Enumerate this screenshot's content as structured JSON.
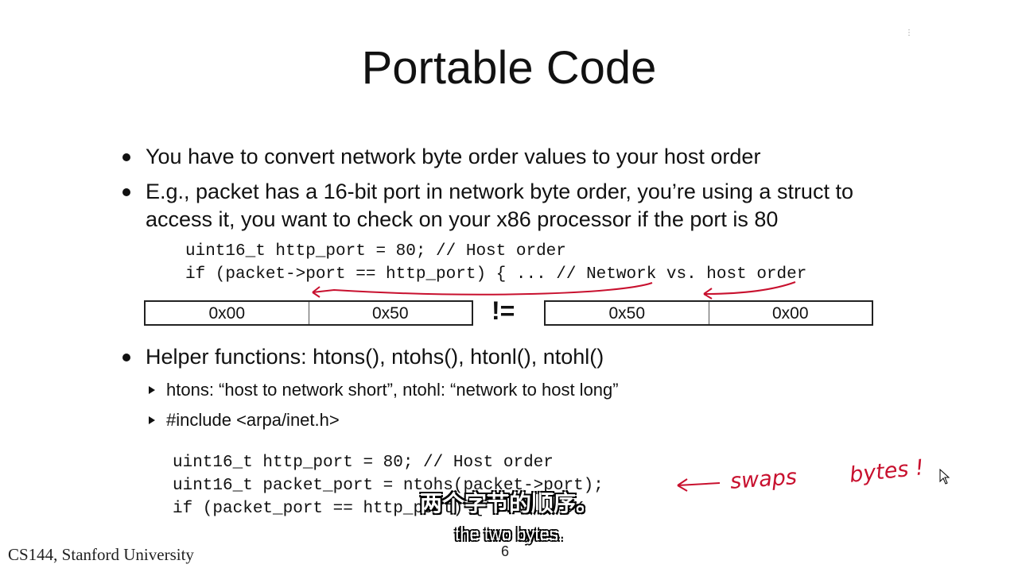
{
  "slide": {
    "title": "Portable Code",
    "bullets": [
      "You have to convert network byte order values to your host order",
      "E.g., packet has a 16-bit port in network byte order, you’re using a struct to",
      "access it, you want to check on your x86 processor if the port is 80"
    ],
    "code_block_1": [
      "uint16_t http_port = 80; // Host order",
      "if (packet->port == http_port) { ... // Network vs. host order"
    ],
    "bytes_left": [
      "0x00",
      "0x50"
    ],
    "not_equal": "!=",
    "bytes_right": [
      "0x50",
      "0x00"
    ],
    "helper_bullet": "Helper functions: htons(), ntohs(), htonl(), ntohl()",
    "sub_bullets": [
      "htons: “host to network short”, ntohl: “network to host long”",
      "#include <arpa/inet.h>"
    ],
    "code_block_2": [
      "uint16_t http_port = 80; // Host order",
      "uint16_t packet_port = ntohs(packet->port);",
      "if (packet_port == http_port) { ... // OK"
    ],
    "annotation": {
      "word1": "swaps",
      "word2": "bytes !"
    },
    "footer": "CS144, Stanford University",
    "page_number": "6"
  },
  "subtitles": {
    "chinese": "两个字节的顺序。",
    "english": "the two bytes."
  },
  "colors": {
    "annotation": "#c8102e",
    "text": "#111111",
    "background": "#ffffff"
  }
}
